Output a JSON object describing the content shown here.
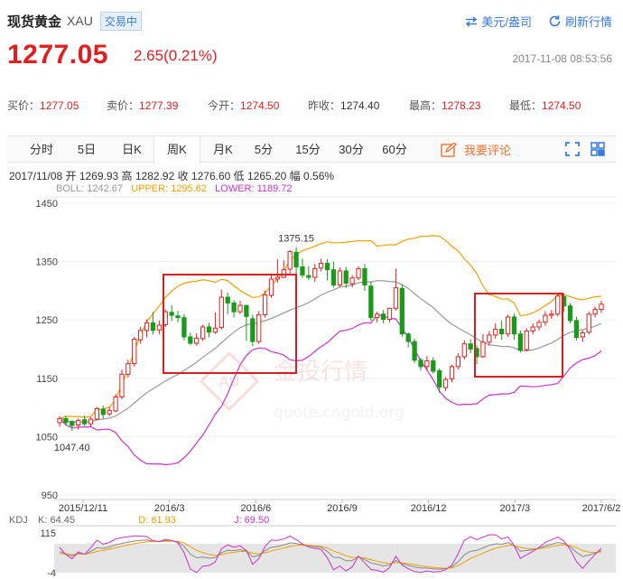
{
  "header": {
    "name": "现货黄金",
    "code": "XAU",
    "status": "交易中",
    "currency_link": "美元/盎司",
    "refresh_link": "刷新行情",
    "price": "1277.05",
    "change": "2.65(0.21%)",
    "timestamp": "2017-11-08 08:53:56",
    "colors": {
      "up": "#e02020",
      "link": "#3a7bd5"
    }
  },
  "quotes": [
    {
      "label": "买价：",
      "value": "1277.05",
      "color": "red"
    },
    {
      "label": "卖价：",
      "value": "1277.39",
      "color": "red"
    },
    {
      "label": "今开：",
      "value": "1274.50",
      "color": "red"
    },
    {
      "label": "昨收：",
      "value": "1274.40",
      "color": "black"
    },
    {
      "label": "最高：",
      "value": "1278.23",
      "color": "red"
    },
    {
      "label": "最低：",
      "value": "1274.50",
      "color": "red"
    }
  ],
  "tabs": [
    "分时",
    "5日",
    "日K",
    "周K",
    "月K",
    "5分",
    "15分",
    "30分",
    "60分"
  ],
  "active_tab": "周K",
  "comment_label": "我要评论",
  "info_line": "2017/11/08  开 1269.93  高 1282.92  收 1276.60  低 1265.20  幅 0.56%",
  "boll_legend": {
    "boll": "BOLL: 1242.67",
    "upper": "UPPER: 1295.62",
    "lower": "LOWER: 1189.72"
  },
  "kdj_legend": {
    "title": "KDJ",
    "k": "K: 64.45",
    "d": "D: 61.93",
    "j": "J: 69.50"
  },
  "watermark": {
    "text": "金投行情",
    "url": "quote.cngold.org"
  },
  "chart_data": {
    "type": "candlestick",
    "y_ticks": [
      1450,
      1350,
      1250,
      1150,
      1050,
      950
    ],
    "ylim": [
      950,
      1450
    ],
    "x_labels": [
      "2015/12/11",
      "2016/3",
      "2016/6",
      "2016/9",
      "2016/12",
      "2017/3",
      "2017/6/2"
    ],
    "annotations": [
      {
        "text": "1375.15",
        "value": 1375.15
      },
      {
        "text": "1047.40",
        "value": 1047.4
      }
    ],
    "series_colors": {
      "up": "#e02020",
      "down": "#1a9a1a",
      "mid": "#999999",
      "upper": "#f0a000",
      "lower": "#cc33cc"
    },
    "candles": [
      [
        1074,
        1081,
        1067,
        1085
      ],
      [
        1081,
        1074,
        1069,
        1086
      ],
      [
        1076,
        1069,
        1060,
        1078
      ],
      [
        1070,
        1078,
        1062,
        1081
      ],
      [
        1079,
        1072,
        1068,
        1086
      ],
      [
        1072,
        1080,
        1067,
        1083
      ],
      [
        1080,
        1098,
        1078,
        1101
      ],
      [
        1097,
        1088,
        1081,
        1103
      ],
      [
        1089,
        1095,
        1085,
        1101
      ],
      [
        1094,
        1118,
        1092,
        1123
      ],
      [
        1118,
        1157,
        1114,
        1165
      ],
      [
        1157,
        1175,
        1151,
        1182
      ],
      [
        1175,
        1217,
        1170,
        1221
      ],
      [
        1216,
        1232,
        1209,
        1238
      ],
      [
        1232,
        1245,
        1220,
        1251
      ],
      [
        1245,
        1232,
        1225,
        1264
      ],
      [
        1233,
        1241,
        1225,
        1249
      ],
      [
        1242,
        1264,
        1238,
        1268
      ],
      [
        1263,
        1258,
        1248,
        1275
      ],
      [
        1257,
        1254,
        1246,
        1266
      ],
      [
        1254,
        1221,
        1215,
        1260
      ],
      [
        1221,
        1210,
        1207,
        1228
      ],
      [
        1210,
        1219,
        1206,
        1227
      ],
      [
        1218,
        1238,
        1214,
        1242
      ],
      [
        1238,
        1229,
        1220,
        1245
      ],
      [
        1229,
        1236,
        1226,
        1263
      ],
      [
        1237,
        1289,
        1233,
        1302
      ],
      [
        1289,
        1279,
        1260,
        1297
      ],
      [
        1279,
        1264,
        1254,
        1284
      ],
      [
        1264,
        1275,
        1260,
        1283
      ],
      [
        1275,
        1256,
        1214,
        1261
      ],
      [
        1252,
        1213,
        1205,
        1259
      ],
      [
        1213,
        1259,
        1209,
        1265
      ],
      [
        1259,
        1293,
        1254,
        1300
      ],
      [
        1292,
        1320,
        1288,
        1330
      ],
      [
        1320,
        1323,
        1314,
        1354
      ],
      [
        1323,
        1336,
        1322,
        1352
      ],
      [
        1337,
        1367,
        1327,
        1370
      ],
      [
        1366,
        1341,
        1328,
        1375
      ],
      [
        1341,
        1327,
        1322,
        1355
      ],
      [
        1326,
        1323,
        1318,
        1342
      ],
      [
        1323,
        1338,
        1315,
        1346
      ],
      [
        1339,
        1347,
        1333,
        1355
      ],
      [
        1347,
        1336,
        1318,
        1354
      ],
      [
        1336,
        1310,
        1306,
        1350
      ],
      [
        1310,
        1334,
        1306,
        1340
      ],
      [
        1334,
        1313,
        1305,
        1341
      ],
      [
        1312,
        1322,
        1306,
        1327
      ],
      [
        1322,
        1338,
        1318,
        1342
      ],
      [
        1338,
        1310,
        1300,
        1346
      ],
      [
        1308,
        1254,
        1248,
        1316
      ],
      [
        1254,
        1260,
        1246,
        1264
      ],
      [
        1260,
        1251,
        1244,
        1267
      ],
      [
        1251,
        1270,
        1246,
        1271
      ],
      [
        1270,
        1305,
        1266,
        1338
      ],
      [
        1304,
        1226,
        1221,
        1311
      ],
      [
        1226,
        1213,
        1203,
        1229
      ],
      [
        1213,
        1181,
        1176,
        1218
      ],
      [
        1181,
        1170,
        1163,
        1185
      ],
      [
        1170,
        1180,
        1164,
        1188
      ],
      [
        1180,
        1162,
        1158,
        1186
      ],
      [
        1163,
        1135,
        1125,
        1167
      ],
      [
        1134,
        1148,
        1128,
        1152
      ],
      [
        1149,
        1170,
        1143,
        1173
      ],
      [
        1170,
        1187,
        1165,
        1193
      ],
      [
        1187,
        1209,
        1182,
        1215
      ],
      [
        1209,
        1200,
        1193,
        1217
      ],
      [
        1201,
        1187,
        1174,
        1207
      ],
      [
        1187,
        1212,
        1185,
        1226
      ],
      [
        1212,
        1224,
        1206,
        1231
      ],
      [
        1224,
        1234,
        1218,
        1244
      ],
      [
        1234,
        1226,
        1216,
        1249
      ],
      [
        1226,
        1255,
        1221,
        1259
      ],
      [
        1255,
        1226,
        1216,
        1261
      ],
      [
        1226,
        1198,
        1194,
        1232
      ],
      [
        1199,
        1231,
        1196,
        1236
      ],
      [
        1231,
        1238,
        1225,
        1244
      ],
      [
        1238,
        1246,
        1232,
        1251
      ],
      [
        1246,
        1258,
        1240,
        1265
      ],
      [
        1258,
        1260,
        1252,
        1267
      ],
      [
        1260,
        1291,
        1256,
        1294
      ],
      [
        1290,
        1274,
        1264,
        1296
      ],
      [
        1274,
        1249,
        1244,
        1279
      ],
      [
        1249,
        1220,
        1215,
        1255
      ],
      [
        1221,
        1228,
        1212,
        1232
      ],
      [
        1229,
        1260,
        1225,
        1264
      ],
      [
        1260,
        1268,
        1254,
        1273
      ],
      [
        1268,
        1277,
        1262,
        1283
      ]
    ],
    "kdj": {
      "ylim": [
        -4,
        115
      ],
      "y_ticks": [
        115,
        -4
      ]
    }
  }
}
